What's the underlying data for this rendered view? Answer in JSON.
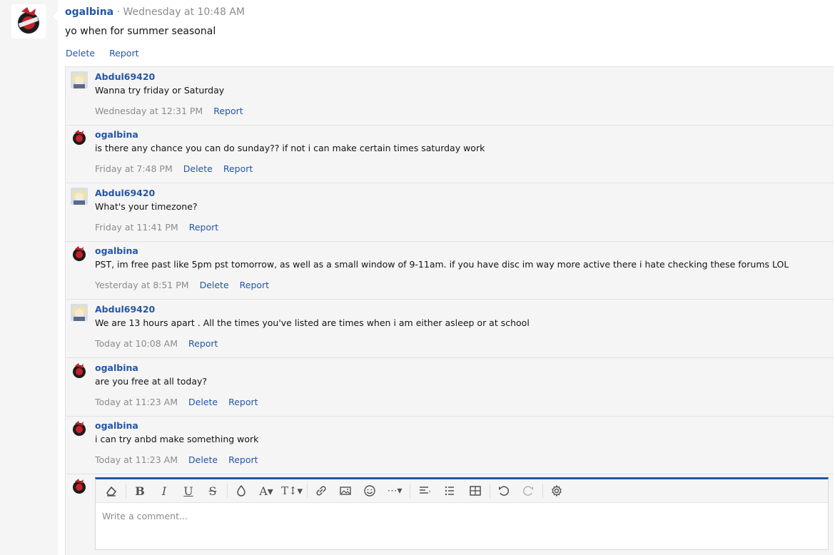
{
  "post": {
    "author": "ogalbina",
    "separator": "·",
    "time": "Wednesday at 10:48 AM",
    "body": "yo when for summer seasonal",
    "actions": {
      "delete": "Delete",
      "report": "Report"
    }
  },
  "comments": [
    {
      "user": "Abdul69420",
      "avatar": "abdul-avatar",
      "text": "Wanna try friday or Saturday",
      "time": "Wednesday at 12:31 PM",
      "can_delete": false
    },
    {
      "user": "ogalbina",
      "avatar": "ogalbina-avatar",
      "text": "is there any chance you can do sunday?? if not i can make certain times saturday work",
      "time": "Friday at 7:48 PM",
      "can_delete": true
    },
    {
      "user": "Abdul69420",
      "avatar": "abdul-avatar",
      "text": "What's your timezone?",
      "time": "Friday at 11:41 PM",
      "can_delete": false
    },
    {
      "user": "ogalbina",
      "avatar": "ogalbina-avatar",
      "text": "PST, im free past like 5pm pst tomorrow, as well as a small window of 9-11am. if you have disc im way more active there i hate checking these forums LOL",
      "time": "Yesterday at 8:51 PM",
      "can_delete": true
    },
    {
      "user": "Abdul69420",
      "avatar": "abdul-avatar",
      "text": "We are 13 hours apart . All the times you've listed are times when i am either asleep or at school",
      "time": "Today at 10:08 AM",
      "can_delete": false
    },
    {
      "user": "ogalbina",
      "avatar": "ogalbina-avatar",
      "text": "are you free at all today?",
      "time": "Today at 11:23 AM",
      "can_delete": true
    },
    {
      "user": "ogalbina",
      "avatar": "ogalbina-avatar",
      "text": "i can try anbd make something work",
      "time": "Today at 11:23 AM",
      "can_delete": true
    }
  ],
  "labels": {
    "delete": "Delete",
    "report": "Report"
  },
  "composer": {
    "placeholder": "Write a comment...",
    "toolbar_icons": [
      "eraser-icon",
      "bold-icon",
      "italic-icon",
      "underline-icon",
      "strikethrough-icon",
      "text-color-icon",
      "font-family-icon",
      "font-size-icon",
      "link-icon",
      "image-icon",
      "emoji-icon",
      "more-icon",
      "align-icon",
      "list-icon",
      "table-icon",
      "undo-icon",
      "redo-icon",
      "settings-icon"
    ]
  },
  "colors": {
    "link": "#2456a6",
    "muted": "#8c8c8c",
    "accent_bar": "#2456a6",
    "panel": "#f5f5f5"
  }
}
